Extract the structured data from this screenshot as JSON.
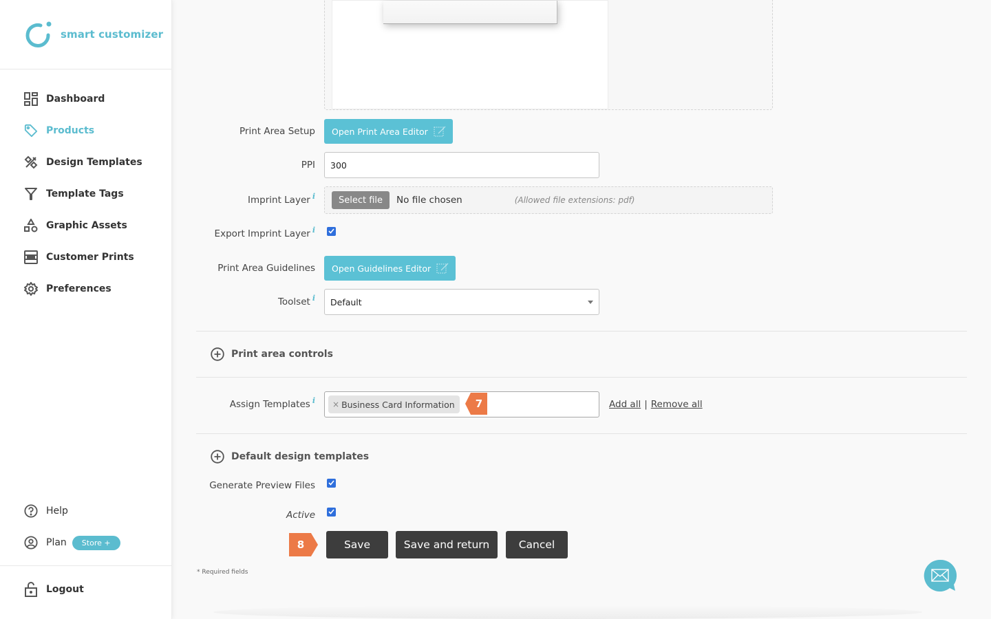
{
  "brand": {
    "name": "smart customizer",
    "color": "#5bbccf"
  },
  "sidebar": {
    "items": [
      {
        "label": "Dashboard",
        "icon": "dashboard-icon",
        "active": false
      },
      {
        "label": "Products",
        "icon": "tag-icon",
        "active": true
      },
      {
        "label": "Design Templates",
        "icon": "design-tools-icon",
        "active": false
      },
      {
        "label": "Template Tags",
        "icon": "filter-icon",
        "active": false
      },
      {
        "label": "Graphic Assets",
        "icon": "shapes-icon",
        "active": false
      },
      {
        "label": "Customer Prints",
        "icon": "prints-icon",
        "active": false
      },
      {
        "label": "Preferences",
        "icon": "gear-icon",
        "active": false
      }
    ],
    "bottom": {
      "help_label": "Help",
      "plan_label": "Plan",
      "plan_badge": "Store +",
      "logout_label": "Logout"
    }
  },
  "form": {
    "print_area_setup": {
      "label": "Print Area Setup",
      "button": "Open Print Area Editor"
    },
    "ppi": {
      "label": "PPI",
      "value": "300"
    },
    "imprint_layer": {
      "label": "Imprint Layer",
      "select_file": "Select file",
      "no_file": "No file chosen",
      "allowed": "(Allowed file extensions: pdf)"
    },
    "export_imprint_layer": {
      "label": "Export Imprint Layer",
      "checked": true
    },
    "print_area_guidelines": {
      "label": "Print Area Guidelines",
      "button": "Open Guidelines Editor"
    },
    "toolset": {
      "label": "Toolset",
      "value": "Default"
    },
    "sections": {
      "print_area_controls": "Print area controls",
      "default_design_templates": "Default design templates"
    },
    "assign_templates": {
      "label": "Assign Templates",
      "tags": [
        "Business Card Information"
      ],
      "add_all": "Add all",
      "separator": "|",
      "remove_all": "Remove all"
    },
    "generate_preview_files": {
      "label": "Generate Preview Files",
      "checked": true
    },
    "active": {
      "label": "Active",
      "checked": true
    },
    "actions": {
      "save": "Save",
      "save_and_return": "Save and return",
      "cancel": "Cancel"
    },
    "required_note": "* Required fields"
  },
  "annotations": {
    "step7": "7",
    "step8": "8",
    "color": "#ec7a47"
  }
}
